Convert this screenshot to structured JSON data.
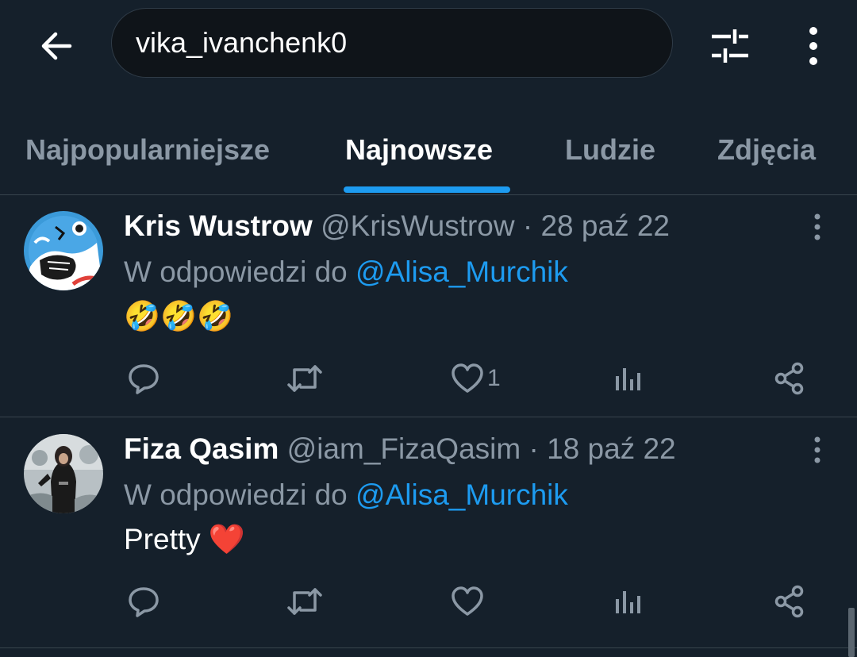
{
  "search": {
    "query": "vika_ivanchenk0"
  },
  "tabs": [
    {
      "label": "Najpopularniejsze",
      "active": false
    },
    {
      "label": "Najnowsze",
      "active": true
    },
    {
      "label": "Ludzie",
      "active": false
    },
    {
      "label": "Zdjęcia",
      "active": false
    }
  ],
  "tweets": [
    {
      "author": "Kris Wustrow",
      "handle": "@KrisWustrow",
      "separator": "·",
      "date": "28 paź 22",
      "reply_prefix": "W odpowiedzi do",
      "reply_to": "@Alisa_Murchik",
      "text": "🤣🤣🤣",
      "likes": "1"
    },
    {
      "author": "Fiza Qasim",
      "handle": "@iam_FizaQasim",
      "separator": "·",
      "date": "18 paź 22",
      "reply_prefix": "W odpowiedzi do",
      "reply_to": "@Alisa_Murchik",
      "text": "Pretty ❤️",
      "likes": ""
    }
  ],
  "icons": {
    "back": "back-arrow-icon",
    "filter": "sliders-icon",
    "more": "more-vertical-icon",
    "reply": "reply-icon",
    "retweet": "retweet-icon",
    "like": "heart-icon",
    "views": "views-icon",
    "share": "share-icon"
  },
  "colors": {
    "background": "#15202b",
    "accent": "#1d9bf0",
    "muted_text": "#8b98a5",
    "divider": "#38444d"
  }
}
